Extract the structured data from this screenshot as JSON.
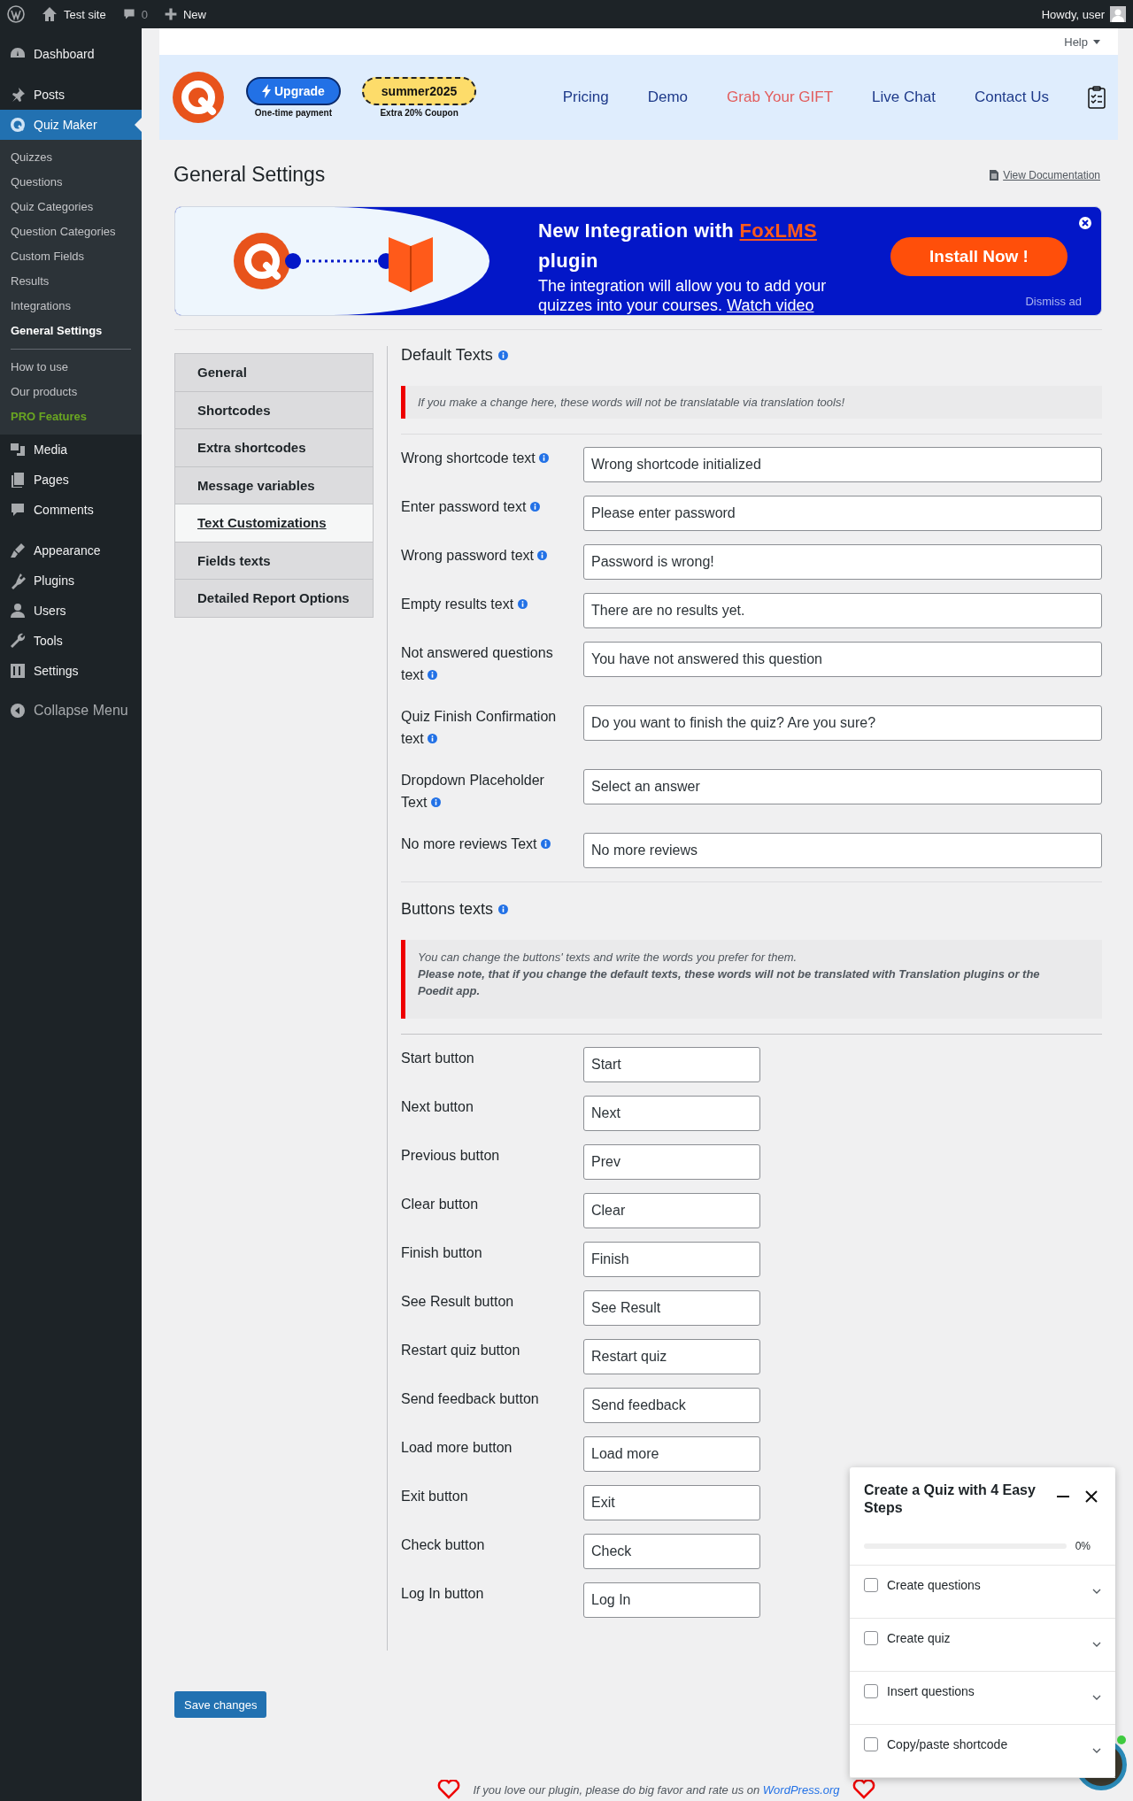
{
  "admin_bar": {
    "site": "Test site",
    "comments": "0",
    "new": "New",
    "howdy": "Howdy, user"
  },
  "sidebar": {
    "groups": [
      [
        {
          "label": "Dashboard",
          "selected": false
        }
      ],
      [
        {
          "label": "Posts",
          "selected": false
        },
        {
          "label": "Quiz Maker",
          "selected": true,
          "submenu": [
            [
              {
                "label": "Quizzes",
                "selected": false,
                "kind": "link"
              },
              {
                "label": "Questions",
                "selected": false,
                "kind": "link"
              },
              {
                "label": "Quiz Categories",
                "selected": false,
                "kind": "link"
              },
              {
                "label": "Question Categories",
                "selected": false,
                "kind": "link"
              },
              {
                "label": "Custom Fields",
                "selected": false,
                "kind": "link"
              },
              {
                "label": "Results",
                "selected": false,
                "kind": "link"
              },
              {
                "label": "Integrations",
                "selected": false,
                "kind": "link"
              },
              {
                "label": "General Settings",
                "selected": true,
                "kind": "link"
              }
            ],
            [
              {
                "label": "How to use",
                "selected": false,
                "kind": "link"
              },
              {
                "label": "Our products",
                "selected": false,
                "kind": "link"
              },
              {
                "label": "PRO Features",
                "selected": false,
                "kind": "pro"
              }
            ]
          ]
        },
        {
          "label": "Media",
          "selected": false
        },
        {
          "label": "Pages",
          "selected": false
        },
        {
          "label": "Comments",
          "selected": false
        }
      ],
      [
        {
          "label": "Appearance",
          "selected": false
        },
        {
          "label": "Plugins",
          "selected": false
        },
        {
          "label": "Users",
          "selected": false
        },
        {
          "label": "Tools",
          "selected": false
        },
        {
          "label": "Settings",
          "selected": false
        }
      ]
    ],
    "collapse": "Collapse Menu"
  },
  "header": {
    "help": "Help",
    "upgrade": {
      "label": "Upgrade",
      "caption": "One-time payment"
    },
    "coupon": {
      "code": "summer2025",
      "caption": "Extra 20% Coupon"
    },
    "nav": [
      {
        "label": "Pricing",
        "color": "#1e3a8a"
      },
      {
        "label": "Demo",
        "color": "#1e3a8a"
      },
      {
        "label": "Grab Your GIFT",
        "color": "#e25c5c"
      },
      {
        "label": "Live Chat",
        "color": "#1e3a8a"
      },
      {
        "label": "Contact Us",
        "color": "#1e3a8a"
      }
    ]
  },
  "page_title": "General Settings",
  "doc_link": "View Documentation",
  "banner": {
    "title_prefix": "New Integration with",
    "brand": "FoxLMS",
    "title_suffix": "plugin",
    "text": "The integration will allow you to add your quizzes into your courses.",
    "video_link": "Watch video",
    "install": "Install Now !",
    "dismiss": "Dismiss ad"
  },
  "tabs": [
    {
      "label": "General",
      "selected": false
    },
    {
      "label": "Shortcodes",
      "selected": false
    },
    {
      "label": "Extra shortcodes",
      "selected": false
    },
    {
      "label": "Message variables",
      "selected": false
    },
    {
      "label": "Text Customizations",
      "selected": true
    },
    {
      "label": "Fields texts",
      "selected": false
    },
    {
      "label": "Detailed Report Options",
      "selected": false
    }
  ],
  "default_texts": {
    "heading": "Default Texts",
    "notice": "If you make a change here, these words will not be translatable via translation tools!",
    "fields": [
      {
        "label": "Wrong shortcode text",
        "value": "Wrong shortcode initialized"
      },
      {
        "label": "Enter password text",
        "value": "Please enter password"
      },
      {
        "label": "Wrong password text",
        "value": "Password is wrong!"
      },
      {
        "label": "Empty results text",
        "value": "There are no results yet."
      },
      {
        "label": "Not answered questions text",
        "value": "You have not answered this question"
      },
      {
        "label": "Quiz Finish Confirmation text",
        "value": "Do you want to finish the quiz? Are you sure?"
      },
      {
        "label": "Dropdown Placeholder Text",
        "value": "Select an answer"
      },
      {
        "label": "No more reviews Text",
        "value": "No more reviews"
      }
    ]
  },
  "buttons_texts": {
    "heading": "Buttons texts",
    "notice": "You can change the buttons' texts and write the words you prefer for them.",
    "notice_bold": "Please note, that if you change the default texts, these words will not be translated with Translation plugins or the Poedit app.",
    "fields": [
      {
        "label": "Start button",
        "value": "Start"
      },
      {
        "label": "Next button",
        "value": "Next"
      },
      {
        "label": "Previous button",
        "value": "Prev"
      },
      {
        "label": "Clear button",
        "value": "Clear"
      },
      {
        "label": "Finish button",
        "value": "Finish"
      },
      {
        "label": "See Result button",
        "value": "See Result"
      },
      {
        "label": "Restart quiz button",
        "value": "Restart quiz"
      },
      {
        "label": "Send feedback button",
        "value": "Send feedback"
      },
      {
        "label": "Load more button",
        "value": "Load more"
      },
      {
        "label": "Exit button",
        "value": "Exit"
      },
      {
        "label": "Check button",
        "value": "Check"
      },
      {
        "label": "Log In button",
        "value": "Log In"
      }
    ]
  },
  "save": "Save changes",
  "footer": {
    "text": "If you love our plugin, please do big favor and rate us on",
    "link": "WordPress.org"
  },
  "popup": {
    "title": "Create a Quiz with 4 Easy Steps",
    "progress": {
      "level": 0,
      "reading": "0%"
    },
    "steps": [
      {
        "label": "Create questions",
        "checked": false
      },
      {
        "label": "Create quiz",
        "checked": false
      },
      {
        "label": "Insert questions",
        "checked": false
      },
      {
        "label": "Copy/paste shortcode",
        "checked": false
      }
    ]
  }
}
